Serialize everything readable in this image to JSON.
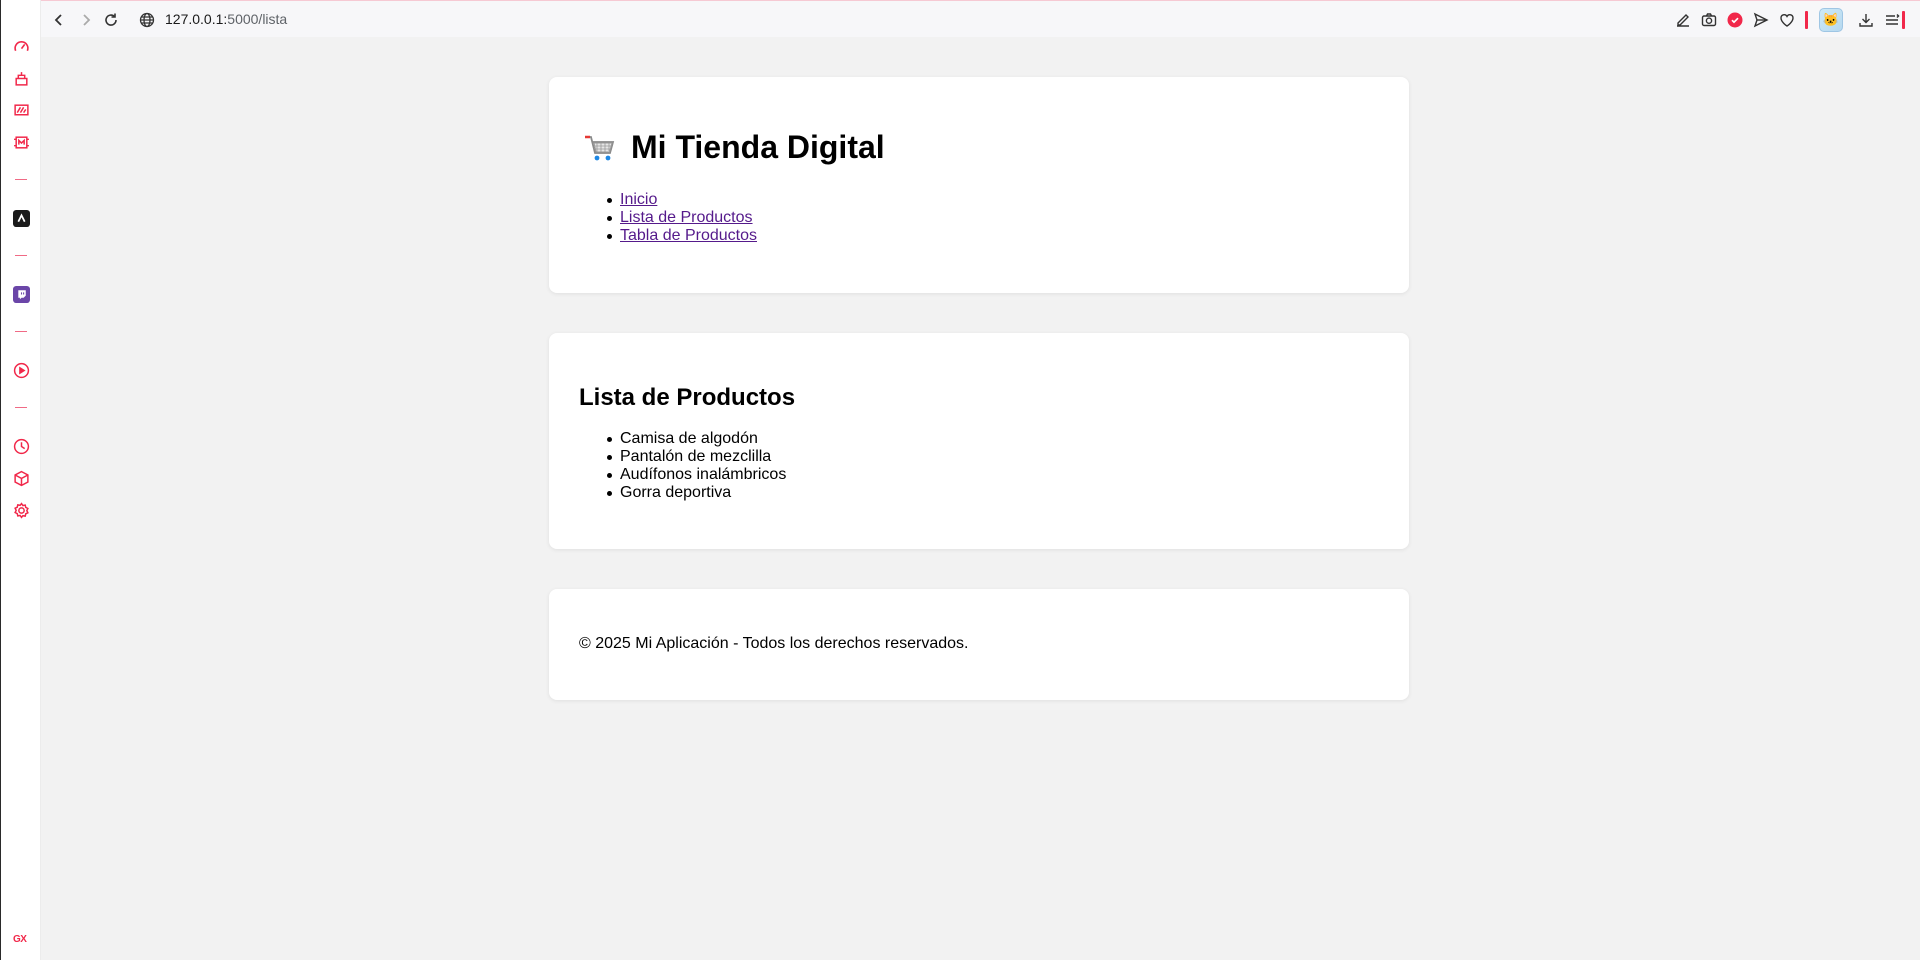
{
  "browser": {
    "url_host": "127.0.0.1:",
    "url_path": "5000/lista",
    "accent_color": "#f1284a"
  },
  "sidebar": {
    "items": [
      {
        "icon": "speed-dial-icon"
      },
      {
        "icon": "clean-icon"
      },
      {
        "icon": "gaming-icon"
      },
      {
        "icon": "memory-icon"
      },
      {
        "icon": "aria-icon"
      },
      {
        "icon": "twitch-icon"
      },
      {
        "icon": "player-icon"
      },
      {
        "icon": "history-icon"
      },
      {
        "icon": "extensions-icon"
      },
      {
        "icon": "settings-icon"
      }
    ],
    "brand": "GX"
  },
  "header": {
    "title": "Mi Tienda Digital",
    "nav": [
      "Inicio",
      "Lista de Productos",
      "Tabla de Productos"
    ]
  },
  "main": {
    "heading": "Lista de Productos",
    "products": [
      "Camisa de algodón",
      "Pantalón de mezclilla",
      "Audífonos inalámbricos",
      "Gorra deportiva"
    ]
  },
  "footer": {
    "text": "© 2025 Mi Aplicación - Todos los derechos reservados."
  }
}
